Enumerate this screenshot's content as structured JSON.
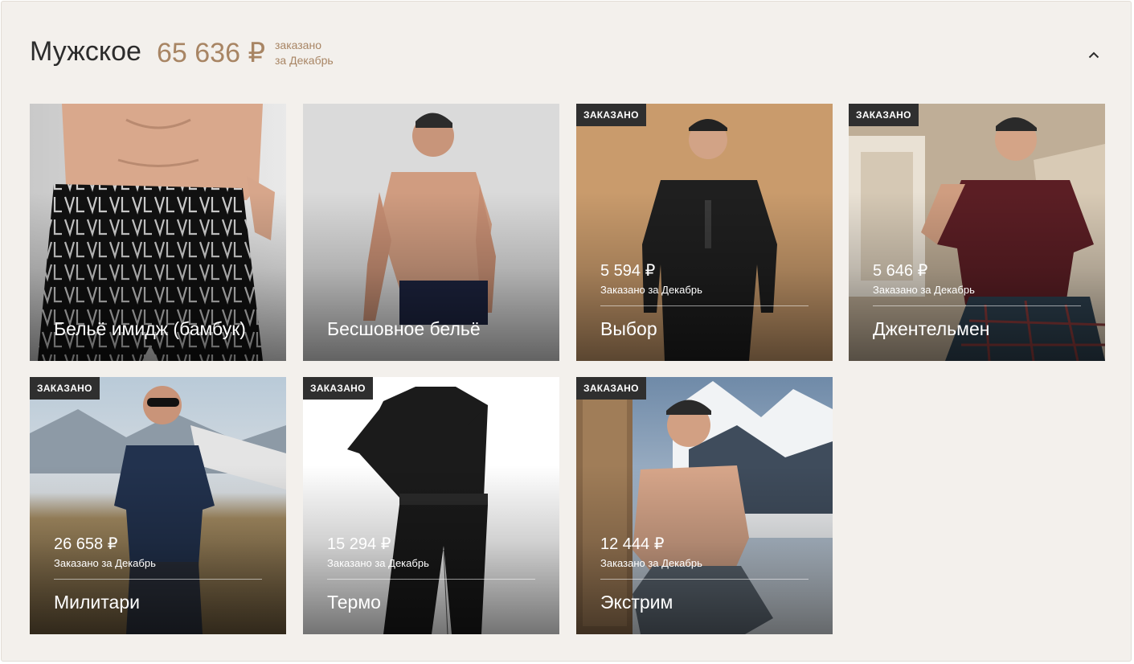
{
  "section": {
    "title": "Мужское",
    "total": "65 636 ₽",
    "total_note_line1": "заказано",
    "total_note_line2": "за Декабрь"
  },
  "colors": {
    "accent": "#a88564",
    "badge_bg": "#2f2f2f",
    "panel_bg": "#f3f0ec"
  },
  "icons": {
    "collapse": "chevron-up-icon"
  },
  "cards": [
    {
      "name": "Бельё имидж (бамбук)",
      "badge": "",
      "price": "",
      "ordered_label": ""
    },
    {
      "name": "Бесшовное бельё",
      "badge": "",
      "price": "",
      "ordered_label": ""
    },
    {
      "name": "Выбор",
      "badge": "ЗАКАЗАНО",
      "price": "5 594 ₽",
      "ordered_label": "Заказано за Декабрь"
    },
    {
      "name": "Джентельмен",
      "badge": "ЗАКАЗАНО",
      "price": "5 646 ₽",
      "ordered_label": "Заказано за Декабрь"
    },
    {
      "name": "Милитари",
      "badge": "ЗАКАЗАНО",
      "price": "26 658 ₽",
      "ordered_label": "Заказано за Декабрь"
    },
    {
      "name": "Термо",
      "badge": "ЗАКАЗАНО",
      "price": "15 294 ₽",
      "ordered_label": "Заказано за Декабрь"
    },
    {
      "name": "Экстрим",
      "badge": "ЗАКАЗАНО",
      "price": "12 444 ₽",
      "ordered_label": "Заказано за Декабрь"
    }
  ]
}
